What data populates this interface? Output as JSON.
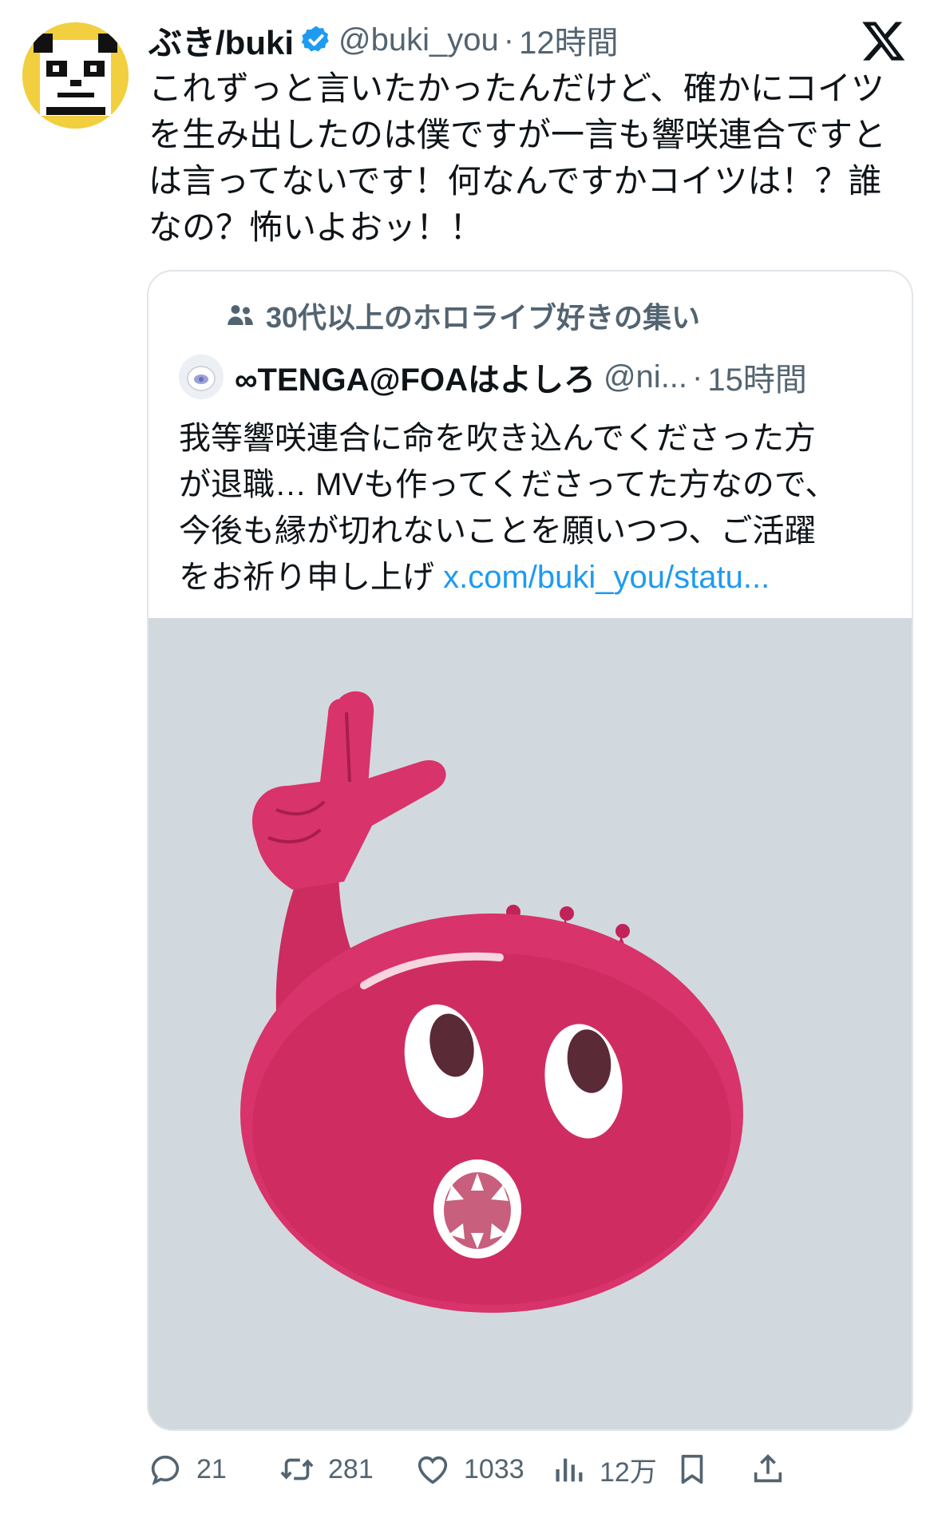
{
  "tweet": {
    "display_name": "ぶき/buki",
    "handle": "@buki_you",
    "separator": "·",
    "time": "12時間",
    "lines": [
      "これずっと言いたかったんだけど、確かにコイツ",
      "を生み出したのは僕ですが一言も響咲連合ですと",
      "は言ってないです！何なんですかコイツは！？誰",
      "なの？怖いよおッ！！"
    ]
  },
  "quote": {
    "community": "30代以上のホロライブ好きの集い",
    "display_name": "∞TENGA@FOAはよしろ",
    "handle": "@ni...",
    "separator": "·",
    "time": "15時間",
    "lines": [
      "我等響咲連合に命を吹き込んでくださった方",
      "が退職… MVも作ってくださってた方なので、",
      "今後も縁が切れないことを願いつつ、ご活躍"
    ],
    "last_line_text": "をお祈り申し上げ ",
    "link": "x.com/buki_you/statu..."
  },
  "actions": {
    "replies": "21",
    "reposts": "281",
    "likes": "1033",
    "views": "12万"
  },
  "icons": {
    "avatar": "pixel-panda-avatar",
    "verified": "verified-badge-icon",
    "logo": "x-logo-icon",
    "community": "people-icon",
    "reply": "reply-icon",
    "repost": "repost-icon",
    "like": "heart-icon",
    "views": "views-icon",
    "bookmark": "bookmark-icon",
    "share": "share-icon"
  },
  "colors": {
    "link": "#1d9bf0",
    "secondary_text": "#536471",
    "media_background": "#d2d9de",
    "character": "#d9336a"
  }
}
